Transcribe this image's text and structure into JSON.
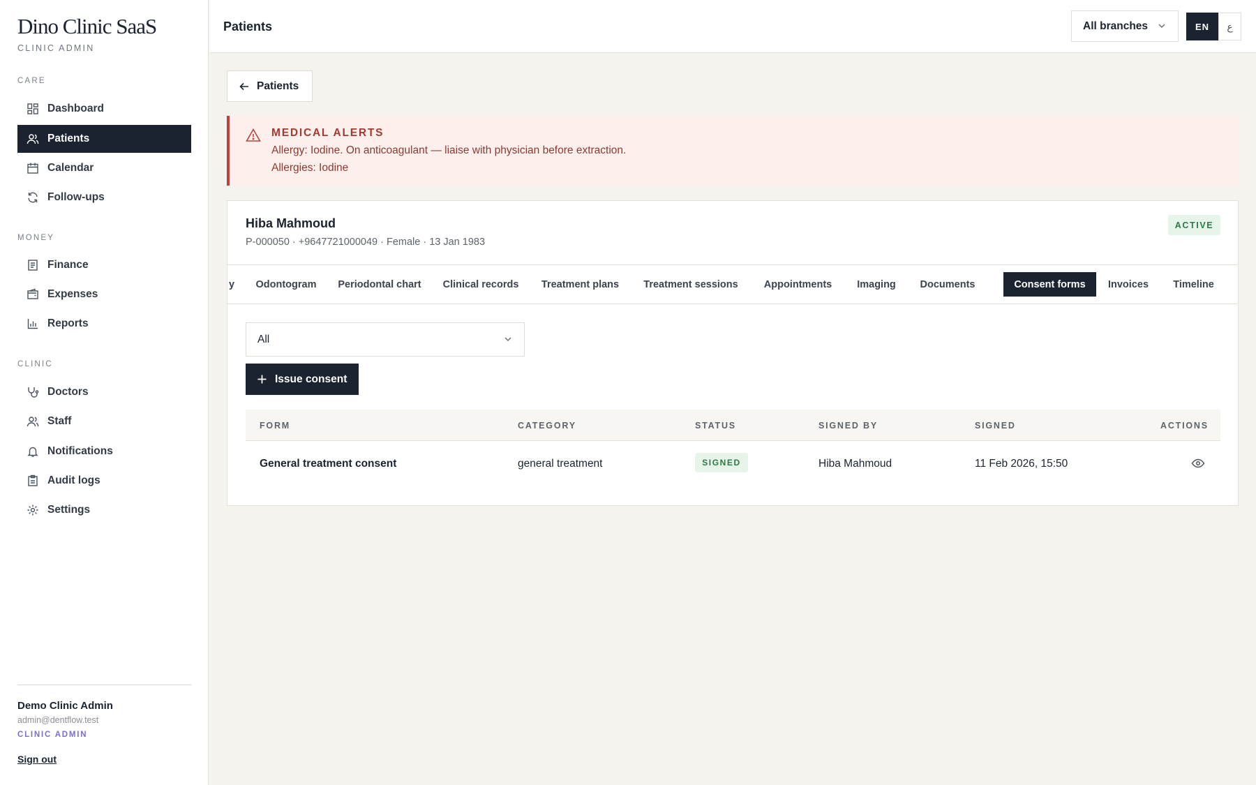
{
  "sidebar": {
    "brand": "Dino Clinic SaaS",
    "brand_subtitle": "CLINIC ADMIN",
    "sections": [
      {
        "label": "CARE",
        "items": [
          {
            "label": "Dashboard",
            "icon": "dashboard-icon"
          },
          {
            "label": "Patients",
            "icon": "users-icon",
            "active": true
          },
          {
            "label": "Calendar",
            "icon": "calendar-icon"
          },
          {
            "label": "Follow-ups",
            "icon": "refresh-icon"
          }
        ]
      },
      {
        "label": "MONEY",
        "items": [
          {
            "label": "Finance",
            "icon": "receipt-icon"
          },
          {
            "label": "Expenses",
            "icon": "wallet-icon"
          },
          {
            "label": "Reports",
            "icon": "bar-chart-icon"
          }
        ]
      },
      {
        "label": "CLINIC",
        "items": [
          {
            "label": "Doctors",
            "icon": "stethoscope-icon"
          },
          {
            "label": "Staff",
            "icon": "users-icon"
          },
          {
            "label": "Notifications",
            "icon": "bell-icon"
          },
          {
            "label": "Audit logs",
            "icon": "clipboard-icon"
          },
          {
            "label": "Settings",
            "icon": "gear-icon"
          }
        ]
      }
    ],
    "user": {
      "name": "Demo Clinic Admin",
      "email": "admin@dentflow.test",
      "role": "CLINIC ADMIN",
      "sign_out": "Sign out"
    }
  },
  "header": {
    "title": "Patients",
    "branch_select": "All branches",
    "lang_en": "EN",
    "lang_ar": "ع"
  },
  "back_button": "Patients",
  "alert": {
    "title": "MEDICAL ALERTS",
    "line1": "Allergy: Iodine. On anticoagulant — liaise with physician before extraction.",
    "line2": "Allergies: Iodine",
    "color": "#b9433b"
  },
  "patient": {
    "name": "Hiba Mahmoud",
    "meta": "P-000050 · +9647721000049 · Female · 13 Jan 1983",
    "status": "ACTIVE"
  },
  "tabs": [
    {
      "label": "y"
    },
    {
      "label": "Odontogram"
    },
    {
      "label": "Periodontal chart"
    },
    {
      "label": "Clinical records"
    },
    {
      "label": "Treatment plans"
    },
    {
      "label": "Treatment sessions"
    },
    {
      "label": "Appointments"
    },
    {
      "label": "Imaging"
    },
    {
      "label": "Documents"
    },
    {
      "label": "Consent forms",
      "active": true
    },
    {
      "label": "Invoices"
    },
    {
      "label": "Timeline"
    }
  ],
  "consents": {
    "filter_value": "All",
    "issue_button": "Issue consent",
    "columns": [
      "FORM",
      "CATEGORY",
      "STATUS",
      "SIGNED BY",
      "SIGNED",
      "ACTIONS"
    ],
    "rows": [
      {
        "form": "General treatment consent",
        "category": "general treatment",
        "status": "SIGNED",
        "signed_by": "Hiba Mahmoud",
        "signed": "11 Feb 2026, 15:50",
        "action_icon": "eye-icon"
      }
    ]
  },
  "colors": {
    "primary": "#1b2330",
    "success": "#2a7a43",
    "danger": "#b9433b",
    "background": "#f4f3ee"
  }
}
